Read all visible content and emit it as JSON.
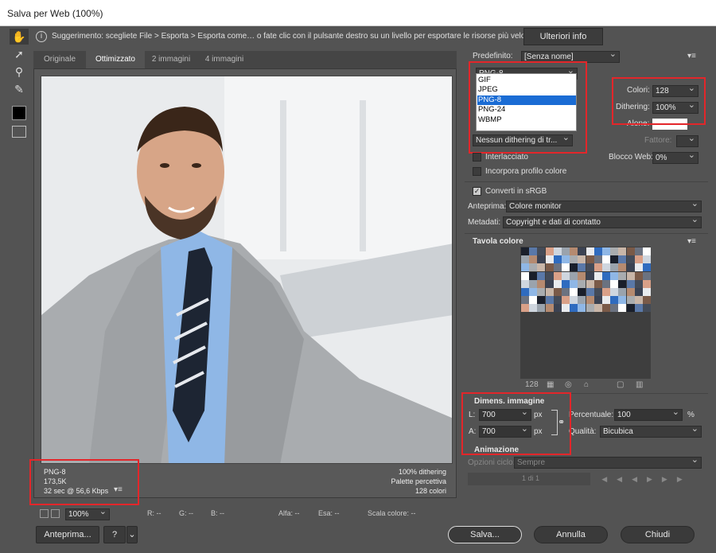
{
  "window": {
    "title": "Salva per Web (100%)"
  },
  "hint": {
    "text": "Suggerimento: scegliete File > Esporta > Esporta come… o fate clic con il pulsante destro su un livello per esportare le risorse più velocemente",
    "button": "Ulteriori info"
  },
  "tabs": [
    "Originale",
    "Ottimizzato",
    "2 immagini",
    "4 immagini"
  ],
  "preview": {
    "info_left": [
      "PNG-8",
      "173,5K",
      "32 sec @ 56,6 Kbps"
    ],
    "info_right": [
      "100% dithering",
      "Palette percettiva",
      "128 colori"
    ]
  },
  "statusbar": {
    "zoom": "100%",
    "r": "R: --",
    "g": "G: --",
    "b": "B: --",
    "alpha": "Alfa: --",
    "hex": "Esa: --",
    "scale": "Scala colore: --"
  },
  "buttons": {
    "preview": "Anteprima...",
    "help": "?",
    "save": "Salva...",
    "cancel": "Annulla",
    "close": "Chiudi"
  },
  "settings": {
    "preset_label": "Predefinito:",
    "preset_value": "[Senza nome]",
    "format_value": "PNG-8",
    "format_options": [
      "GIF",
      "JPEG",
      "PNG-8",
      "PNG-24",
      "WBMP"
    ],
    "colors_label": "Colori:",
    "colors_value": "128",
    "dithering_label": "Dithering:",
    "dithering_value": "100%",
    "matte_label": "Alone:",
    "amount_label": "Fattore:",
    "dither_algo": "Nessun dithering di tr...",
    "websnap_label": "Blocco Web:",
    "websnap_value": "0%",
    "interlaced": "Interlacciato",
    "embed_profile": "Incorpora profilo colore",
    "convert_srgb": "Converti in sRGB",
    "preview_label": "Anteprima:",
    "preview_value": "Colore monitor",
    "metadata_label": "Metadati:",
    "metadata_value": "Copyright e dati di contatto"
  },
  "color_table": {
    "title": "Tavola colore",
    "count": "128"
  },
  "image_size": {
    "title": "Dimens. immagine",
    "w_label": "L:",
    "w_value": "700",
    "h_label": "A:",
    "h_value": "700",
    "unit": "px",
    "percent_label": "Percentuale:",
    "percent_value": "100",
    "percent_unit": "%",
    "quality_label": "Qualità:",
    "quality_value": "Bicubica"
  },
  "animation": {
    "title": "Animazione",
    "loop_label": "Opzioni ciclo:",
    "loop_value": "Sempre",
    "frame": "1 di 1"
  },
  "colors": {
    "accent_red": "#e3262a",
    "selection_blue": "#1a6cd4",
    "panel_bg": "#535353"
  }
}
